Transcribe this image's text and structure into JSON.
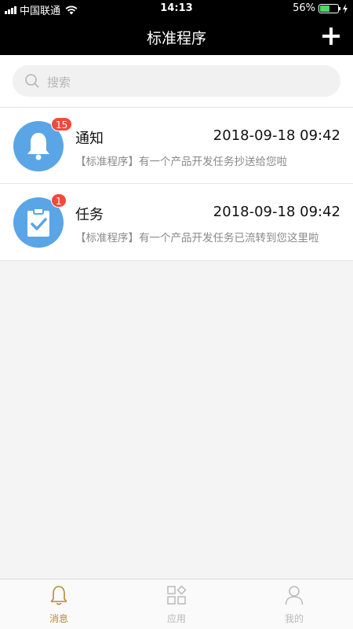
{
  "status_bar": {
    "carrier": "中国联通",
    "time": "14:13",
    "battery": "56%",
    "battery_level": 0.56
  },
  "navbar": {
    "title": "标准程序",
    "add_icon": "plus-icon"
  },
  "search": {
    "placeholder": "搜索",
    "icon": "search-icon"
  },
  "messages": [
    {
      "name": "通知",
      "time": "2018-09-18 09:42",
      "desc": "【标准程序】有一个产品开发任务抄送给您啦",
      "badge": "15",
      "icon": "bell-icon",
      "icon_bg": "#5aa5e6"
    },
    {
      "name": "任务",
      "time": "2018-09-18 09:42",
      "desc": "【标准程序】有一个产品开发任务已流转到您这里啦",
      "badge": "1",
      "icon": "clipboard-check-icon",
      "icon_bg": "#5aa5e6"
    }
  ],
  "tabs": [
    {
      "label": "消息",
      "icon": "bell-outline-icon",
      "active": true
    },
    {
      "label": "应用",
      "icon": "apps-grid-icon",
      "active": false
    },
    {
      "label": "我的",
      "icon": "user-icon",
      "active": false
    }
  ],
  "colors": {
    "accent": "#b78a36",
    "badge": "#ee4b3c",
    "avatar": "#5aa5e6",
    "header": "#000000"
  }
}
